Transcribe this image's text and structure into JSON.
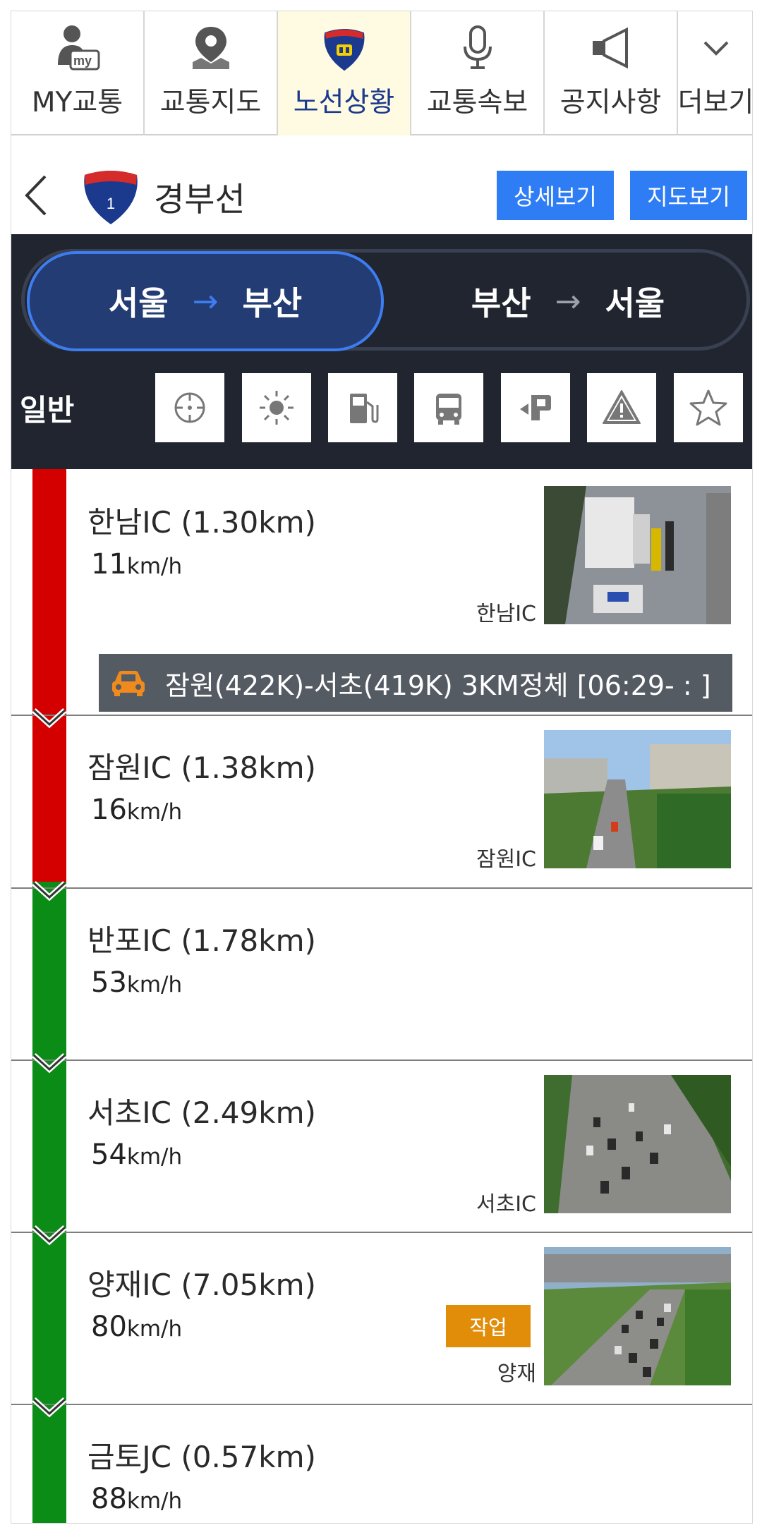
{
  "topnav": {
    "items": [
      {
        "label": "MY교통",
        "icon": "my-traffic-person-icon"
      },
      {
        "label": "교통지도",
        "icon": "map-pin-icon"
      },
      {
        "label": "노선상황",
        "icon": "highway-shield-icon",
        "active": true
      },
      {
        "label": "교통속보",
        "icon": "microphone-icon"
      },
      {
        "label": "공지사항",
        "icon": "megaphone-icon"
      },
      {
        "label": "더보기",
        "icon": "chevron-down-icon"
      }
    ]
  },
  "route": {
    "shield_number": "1",
    "name": "경부선",
    "detail_button": "상세보기",
    "map_button": "지도보기"
  },
  "direction": {
    "left_from": "서울",
    "left_to": "부산",
    "right_from": "부산",
    "right_to": "서울",
    "active": "left",
    "arrow": "→"
  },
  "filters": {
    "label": "일반",
    "icons": [
      "crosshair-target-icon",
      "sun-weather-icon",
      "gas-station-icon",
      "bus-icon",
      "rest-area-parking-icon",
      "warning-triangle-icon",
      "star-favorite-icon"
    ]
  },
  "segments": [
    {
      "name": "한남IC (1.30km)",
      "speed": "11",
      "unit": "km/h",
      "status_color": "#d40000",
      "camera_label": "한남IC",
      "has_camera": true
    },
    {
      "name": "잠원IC (1.38km)",
      "speed": "16",
      "unit": "km/h",
      "status_color": "#d40000",
      "camera_label": "잠원IC",
      "has_camera": true
    },
    {
      "name": "반포IC (1.78km)",
      "speed": "53",
      "unit": "km/h",
      "status_color": "#0a8c17",
      "camera_label": "",
      "has_camera": false
    },
    {
      "name": "서초IC (2.49km)",
      "speed": "54",
      "unit": "km/h",
      "status_color": "#0a8c17",
      "camera_label": "서초IC",
      "has_camera": true
    },
    {
      "name": "양재IC (7.05km)",
      "speed": "80",
      "unit": "km/h",
      "status_color": "#0a8c17",
      "camera_label": "양재",
      "has_camera": true,
      "badge": "작업"
    },
    {
      "name": "금토JC (0.57km)",
      "speed": "88",
      "unit": "km/h",
      "status_color": "#0a8c17",
      "camera_label": "",
      "has_camera": false
    }
  ],
  "incident": {
    "text": "잠원(422K)-서초(419K) 3KM정체 [06:29-  :  ]",
    "icon": "car-accident-icon",
    "icon_color": "#f08a1c"
  },
  "colors": {
    "congested": "#d40000",
    "smooth": "#0a8c17",
    "accent": "#2f7df5",
    "panel": "#20252f"
  }
}
